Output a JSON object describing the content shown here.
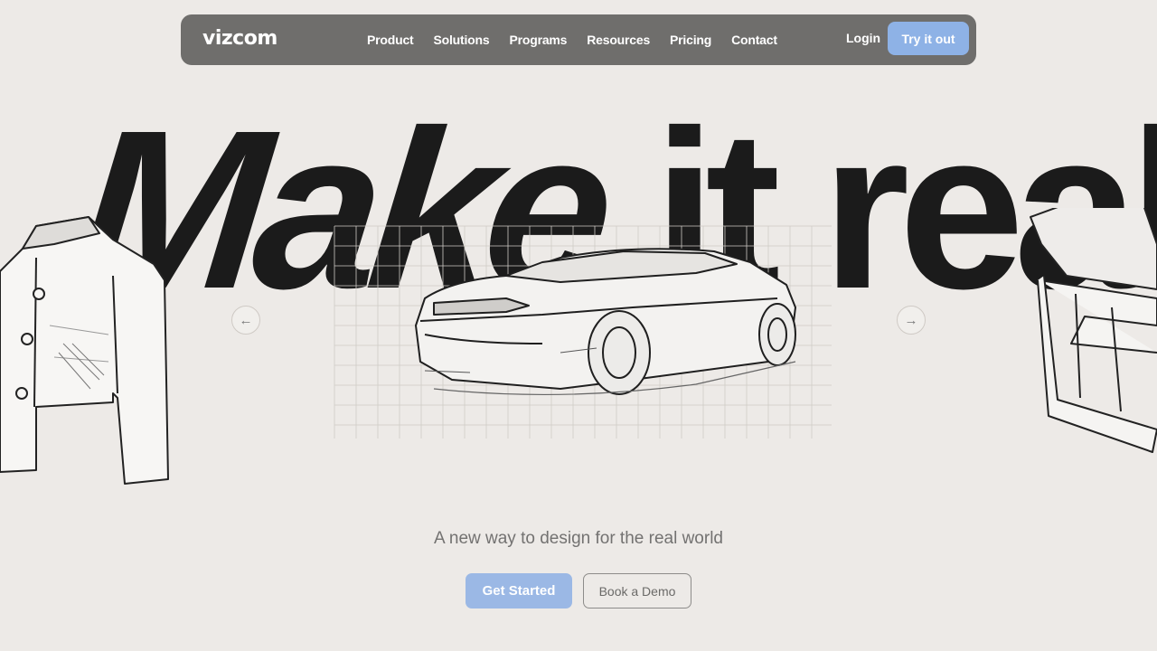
{
  "nav": {
    "logo": "vizcom",
    "links": [
      "Product",
      "Solutions",
      "Programs",
      "Resources",
      "Pricing",
      "Contact"
    ],
    "login": "Login",
    "try_button": "Try it out"
  },
  "hero": {
    "headline_part1": "Make",
    "headline_part2": "it real",
    "tagline": "A new way to design for the real world",
    "primary_cta": "Get Started",
    "secondary_cta": "Book a Demo",
    "prev_arrow": "←",
    "next_arrow": "→"
  },
  "colors": {
    "background": "#edeae7",
    "nav_bg": "#6f6e6c",
    "accent": "#8eb2e6",
    "headline": "#1b1b1b"
  }
}
